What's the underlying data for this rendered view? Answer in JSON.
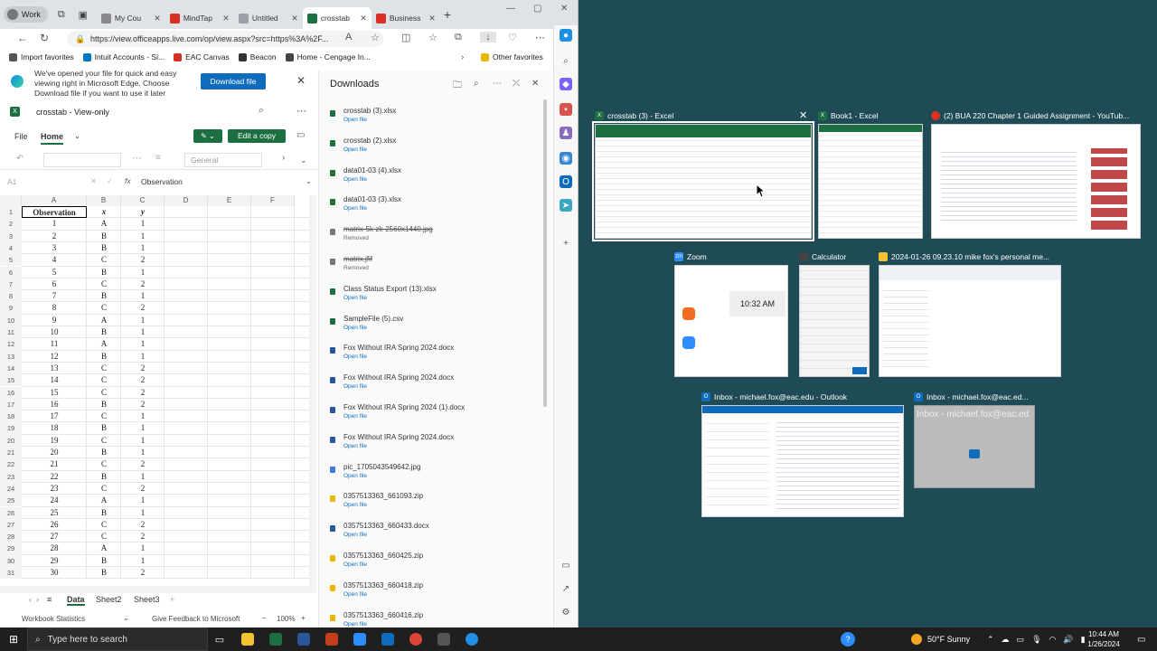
{
  "browser": {
    "profile": "Work",
    "tabs": [
      {
        "label": "My Cou",
        "color": "#8a8a8a"
      },
      {
        "label": "MindTap",
        "color": "#d93025"
      },
      {
        "label": "Untitled",
        "color": "#9aa0a6"
      },
      {
        "label": "crosstab",
        "color": "#1d6f42",
        "active": true
      },
      {
        "label": "Business",
        "color": "#d93025"
      }
    ],
    "url": "https://view.officeapps.live.com/op/view.aspx?src=https%3A%2F...",
    "favorites": [
      {
        "label": "Import favorites",
        "color": "#555555"
      },
      {
        "label": "Intuit Accounts - Si...",
        "color": "#0077c5"
      },
      {
        "label": "EAC Canvas",
        "color": "#d93025"
      },
      {
        "label": "Beacon",
        "color": "#333333"
      },
      {
        "label": "Home - Cengage In...",
        "color": "#444444"
      }
    ],
    "other_favorites": "Other favorites"
  },
  "notice": {
    "text": "We've opened your file for quick and easy viewing right in Microsoft Edge. Choose Download file if you want to use it later",
    "download_button": "Download file"
  },
  "excel": {
    "title": "crosstab  -  View-only",
    "ribbon_file": "File",
    "ribbon_home": "Home",
    "edit_copy": "Edit a copy",
    "number_format": "General",
    "cell_ref": "A1",
    "formula": "Observation",
    "columns": [
      "A",
      "B",
      "C",
      "D",
      "E",
      "F"
    ],
    "headers": [
      "Observation",
      "x",
      "y"
    ],
    "rows": [
      [
        "1",
        "A",
        "1"
      ],
      [
        "2",
        "B",
        "1"
      ],
      [
        "3",
        "B",
        "1"
      ],
      [
        "4",
        "C",
        "2"
      ],
      [
        "5",
        "B",
        "1"
      ],
      [
        "6",
        "C",
        "2"
      ],
      [
        "7",
        "B",
        "1"
      ],
      [
        "8",
        "C",
        "2"
      ],
      [
        "9",
        "A",
        "1"
      ],
      [
        "10",
        "B",
        "1"
      ],
      [
        "11",
        "A",
        "1"
      ],
      [
        "12",
        "B",
        "1"
      ],
      [
        "13",
        "C",
        "2"
      ],
      [
        "14",
        "C",
        "2"
      ],
      [
        "15",
        "C",
        "2"
      ],
      [
        "16",
        "B",
        "2"
      ],
      [
        "17",
        "C",
        "1"
      ],
      [
        "18",
        "B",
        "1"
      ],
      [
        "19",
        "C",
        "1"
      ],
      [
        "20",
        "B",
        "1"
      ],
      [
        "21",
        "C",
        "2"
      ],
      [
        "22",
        "B",
        "1"
      ],
      [
        "23",
        "C",
        "2"
      ],
      [
        "24",
        "A",
        "1"
      ],
      [
        "25",
        "B",
        "1"
      ],
      [
        "26",
        "C",
        "2"
      ],
      [
        "27",
        "C",
        "2"
      ],
      [
        "28",
        "A",
        "1"
      ],
      [
        "29",
        "B",
        "1"
      ],
      [
        "30",
        "B",
        "2"
      ]
    ],
    "sheets": [
      "Data",
      "Sheet2",
      "Sheet3"
    ],
    "status_left": "Workbook Statistics",
    "feedback": "Give Feedback to Microsoft",
    "zoom": "100%"
  },
  "downloads": {
    "title": "Downloads",
    "items": [
      {
        "name": "crosstab (3).xlsx",
        "status": "Open file",
        "color": "#1d6f42"
      },
      {
        "name": "crosstab (2).xlsx",
        "status": "Open file",
        "color": "#1d6f42"
      },
      {
        "name": "data01-03 (4).xlsx",
        "status": "Open file",
        "color": "#1d6f42"
      },
      {
        "name": "data01-03 (3).xlsx",
        "status": "Open file",
        "color": "#1d6f42"
      },
      {
        "name": "matrix-5k-zk-2560x1440.jpg",
        "status": "Removed",
        "color": "#777777",
        "removed": true
      },
      {
        "name": "matrix.jfif",
        "status": "Removed",
        "color": "#777777",
        "removed": true
      },
      {
        "name": "Class Status Export (13).xlsx",
        "status": "Open file",
        "color": "#1d6f42"
      },
      {
        "name": "SampleFile (5).csv",
        "status": "Open file",
        "color": "#1d6f42"
      },
      {
        "name": "Fox Without IRA Spring 2024.docx",
        "status": "Open file",
        "color": "#2b579a"
      },
      {
        "name": "Fox Without IRA Spring 2024.docx",
        "status": "Open file",
        "color": "#2b579a"
      },
      {
        "name": "Fox Without IRA Spring 2024 (1).docx",
        "status": "Open file",
        "color": "#2b579a"
      },
      {
        "name": "Fox Without IRA Spring 2024.docx",
        "status": "Open file",
        "color": "#2b579a"
      },
      {
        "name": "pic_1705043549642.jpg",
        "status": "Open file",
        "color": "#3b7dd8"
      },
      {
        "name": "0357513363_661093.zip",
        "status": "Open file",
        "color": "#e8b800"
      },
      {
        "name": "0357513363_660433.docx",
        "status": "Open file",
        "color": "#2b579a"
      },
      {
        "name": "0357513363_660425.zip",
        "status": "Open file",
        "color": "#e8b800"
      },
      {
        "name": "0357513363_660418.zip",
        "status": "Open file",
        "color": "#e8b800"
      },
      {
        "name": "0357513363_660416.zip",
        "status": "Open file",
        "color": "#e8b800"
      }
    ]
  },
  "taskview": {
    "windows": [
      {
        "title": "crosstab (3) - Excel",
        "icon_color": "#1d6f42"
      },
      {
        "title": "Book1 - Excel",
        "icon_color": "#1d6f42"
      },
      {
        "title": "(2) BUA 220 Chapter 1 Guided Assignment - YouTub...",
        "icon_color": "#d93025"
      },
      {
        "title": "Zoom",
        "icon_color": "#2d8cff"
      },
      {
        "title": "Calculator",
        "icon_color": "#444444"
      },
      {
        "title": "2024-01-26 09.23.10 mike fox's personal me...",
        "icon_color": "#f2c231"
      },
      {
        "title": "Inbox - michael.fox@eac.edu - Outlook",
        "icon_color": "#0f6cbd"
      },
      {
        "title": "Inbox - michael.fox@eac.ed...",
        "icon_color": "#0f6cbd"
      }
    ],
    "zoom_time": "10:32 AM",
    "outlook_preview": "Inbox - michael.fox@eac.ed"
  },
  "taskbar": {
    "search_placeholder": "Type here to search",
    "weather": "50°F  Sunny",
    "time": "10:44 AM",
    "date": "1/26/2024"
  }
}
